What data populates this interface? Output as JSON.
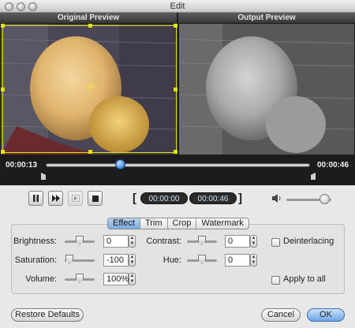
{
  "window": {
    "title": "Edit"
  },
  "preview": {
    "original_label": "Original Preview",
    "output_label": "Output Preview"
  },
  "playback": {
    "current_time": "00:00:13",
    "total_time": "00:00:46",
    "start_time": "00:00:00",
    "end_time": "00:00:46",
    "progress_fraction": 0.28
  },
  "tabs": [
    "Effect",
    "Trim",
    "Crop",
    "Watermark"
  ],
  "effect": {
    "brightness_label": "Brightness:",
    "brightness_value": "0",
    "saturation_label": "Saturation:",
    "saturation_value": "-100",
    "volume_label": "Volume:",
    "volume_value": "100%",
    "contrast_label": "Contrast:",
    "contrast_value": "0",
    "hue_label": "Hue:",
    "hue_value": "0",
    "deinterlacing_label": "Deinterlacing",
    "apply_all_label": "Apply to all"
  },
  "buttons": {
    "restore": "Restore Defaults",
    "cancel": "Cancel",
    "ok": "OK"
  },
  "colors": {
    "crop_border": "#e6e200",
    "accent": "#3b84d3"
  }
}
